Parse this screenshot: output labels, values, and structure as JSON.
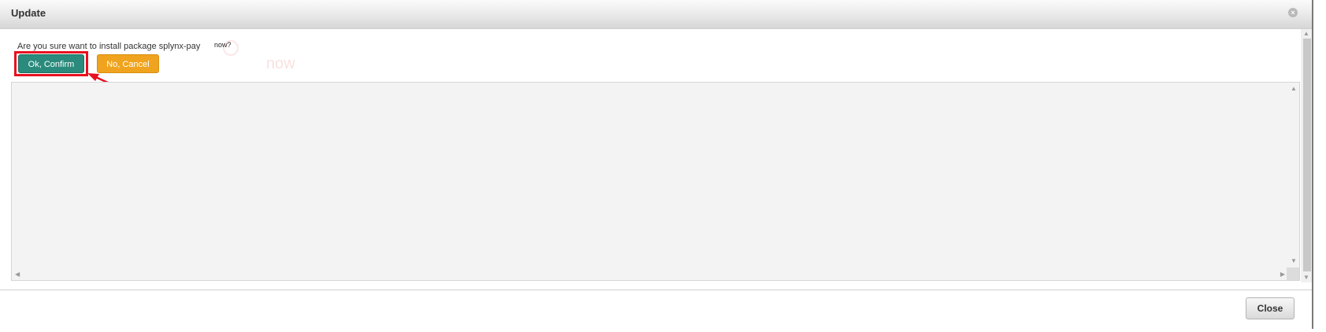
{
  "window": {
    "title": "Update",
    "close_icon": "close-circle-icon"
  },
  "prompt": {
    "text": "Are you sure want to install package splynx-pay",
    "suffix": "now?",
    "ghost_text": "now"
  },
  "buttons": {
    "confirm_label": "Ok, Confirm",
    "cancel_label": "No, Cancel",
    "close_label": "Close"
  },
  "colors": {
    "confirm": "#2a8a7c",
    "cancel": "#f0a31e",
    "annotation": "#e8101e"
  },
  "annotation": {
    "type": "red-box-and-arrow",
    "target": "confirm-button"
  }
}
